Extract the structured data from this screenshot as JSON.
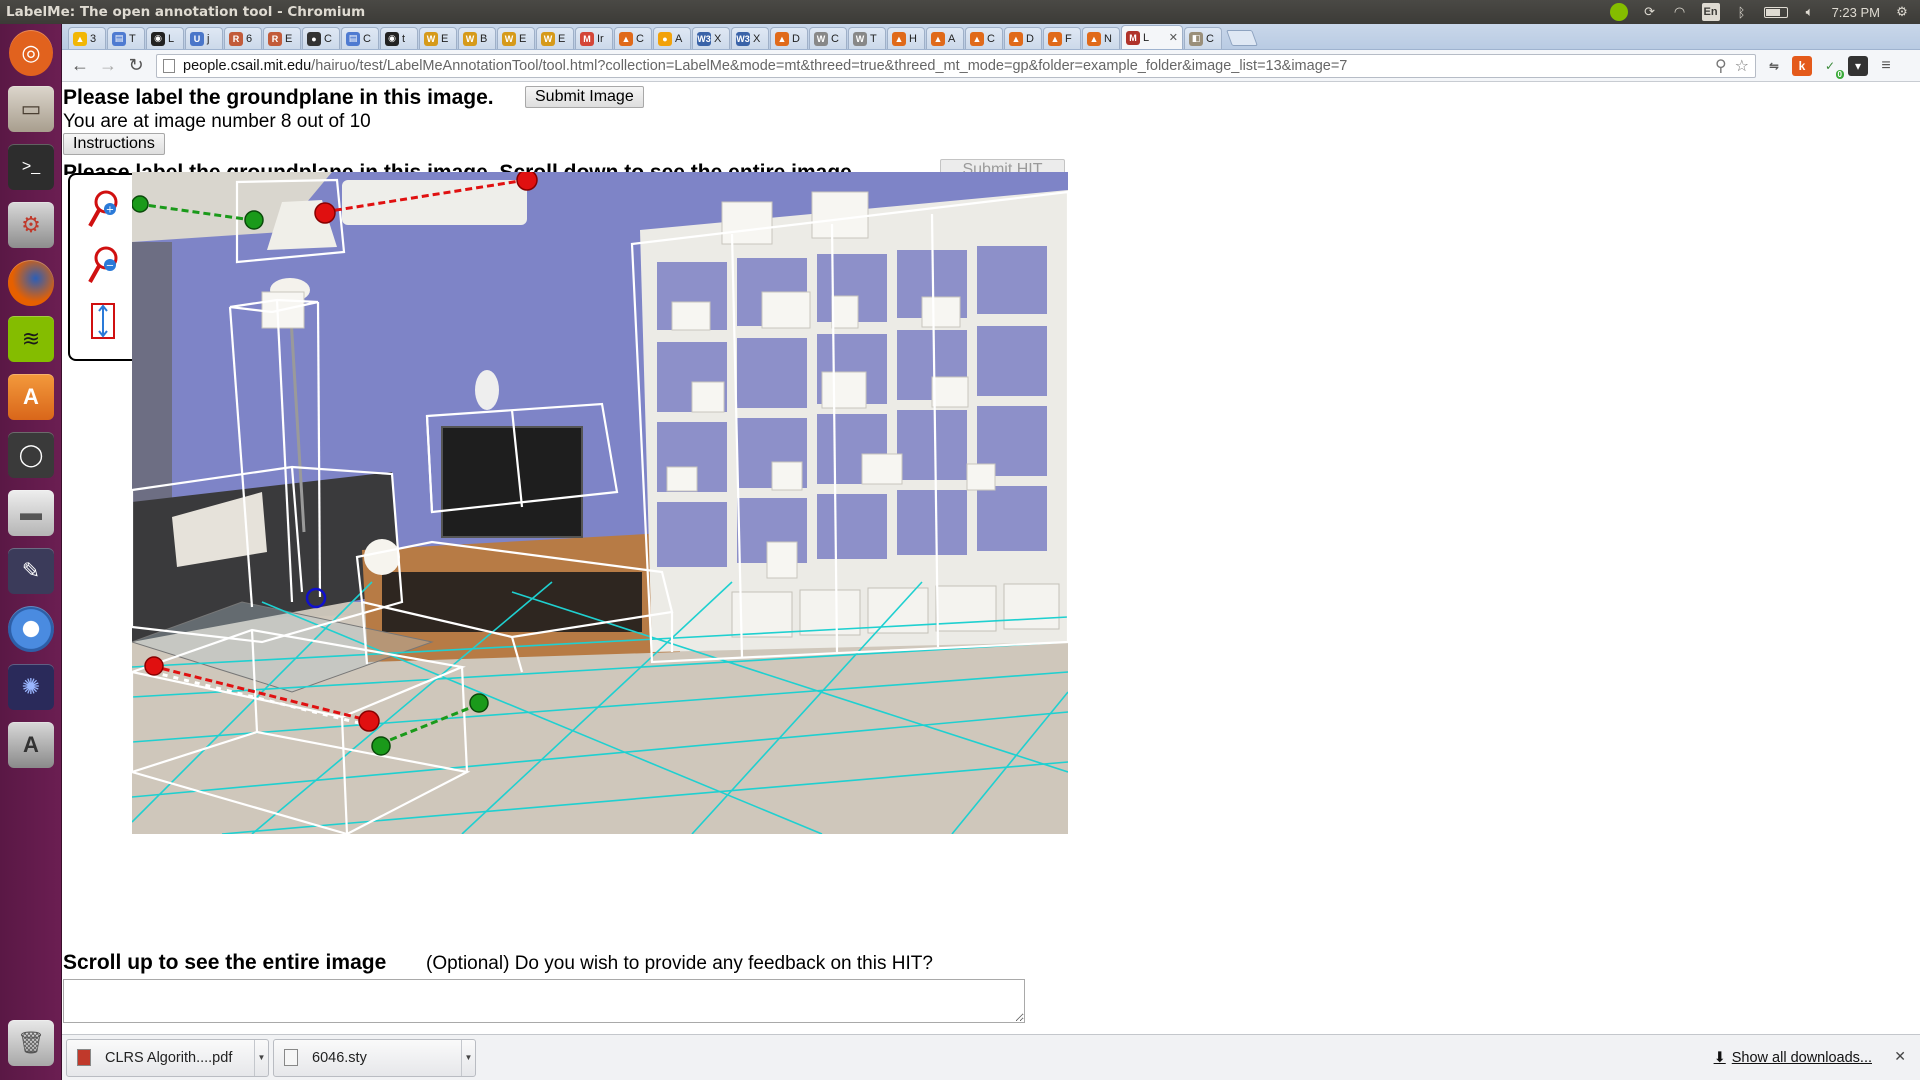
{
  "window": {
    "title": "LabelMe: The open annotation tool - Chromium",
    "clock": "7:23 PM",
    "lang": "En"
  },
  "tabs": [
    {
      "label": "3",
      "color": "#f2b705",
      "glyph": "▲"
    },
    {
      "label": "T",
      "color": "#4f7bd1",
      "glyph": "▤"
    },
    {
      "label": "L",
      "color": "#222222",
      "glyph": "◉"
    },
    {
      "label": "j",
      "color": "#4a76c9",
      "glyph": "U"
    },
    {
      "label": "6",
      "color": "#c25b3a",
      "glyph": "R"
    },
    {
      "label": "E",
      "color": "#c25b3a",
      "glyph": "R"
    },
    {
      "label": "C",
      "color": "#333333",
      "glyph": "●"
    },
    {
      "label": "C",
      "color": "#4f7bd1",
      "glyph": "▤"
    },
    {
      "label": "t",
      "color": "#222222",
      "glyph": "◉"
    },
    {
      "label": "E",
      "color": "#d69a1a",
      "glyph": "W"
    },
    {
      "label": "B",
      "color": "#d69a1a",
      "glyph": "W"
    },
    {
      "label": "E",
      "color": "#d69a1a",
      "glyph": "W"
    },
    {
      "label": "E",
      "color": "#d69a1a",
      "glyph": "W"
    },
    {
      "label": "Ir",
      "color": "#d44638",
      "glyph": "M"
    },
    {
      "label": "C",
      "color": "#e06a1a",
      "glyph": "▲"
    },
    {
      "label": "A",
      "color": "#f2a20a",
      "glyph": "●"
    },
    {
      "label": "X",
      "color": "#3a63a8",
      "glyph": "W3"
    },
    {
      "label": "X",
      "color": "#3a63a8",
      "glyph": "W3"
    },
    {
      "label": "D",
      "color": "#e06a1a",
      "glyph": "▲"
    },
    {
      "label": "C",
      "color": "#888888",
      "glyph": "W"
    },
    {
      "label": "T",
      "color": "#888888",
      "glyph": "W"
    },
    {
      "label": "H",
      "color": "#e06a1a",
      "glyph": "▲"
    },
    {
      "label": "A",
      "color": "#e06a1a",
      "glyph": "▲"
    },
    {
      "label": "C",
      "color": "#e06a1a",
      "glyph": "▲"
    },
    {
      "label": "D",
      "color": "#e06a1a",
      "glyph": "▲"
    },
    {
      "label": "F",
      "color": "#e06a1a",
      "glyph": "▲"
    },
    {
      "label": "N",
      "color": "#e06a1a",
      "glyph": "▲"
    },
    {
      "label": "L",
      "color": "#b0332b",
      "glyph": "M",
      "active": true
    },
    {
      "label": "C",
      "color": "#9a8f7a",
      "glyph": "◧"
    }
  ],
  "toolbar": {
    "url_host": "people.csail.mit.edu",
    "url_path": "/hairuo/test/LabelMeAnnotationTool/tool.html?collection=LabelMe&mode=mt&threed=true&threed_mt_mode=gp&folder=example_folder&image_list=13&image=7",
    "ext_badge": "0"
  },
  "page": {
    "heading": "Please label the groundplane in this image.",
    "submit_image": "Submit Image",
    "image_counter": "You are at image number 8 out of 10",
    "instructions": "Instructions",
    "heading2": "Please label the groundplane in this image. Scroll down to see the entire image.",
    "submit_hit": "Submit HIT",
    "scroll_up": "Scroll up to see the entire image",
    "feedback_question": "(Optional) Do you wish to provide any feedback on this HIT?",
    "feedback_value": ""
  },
  "zoom_tools": [
    {
      "name": "zoom-in-icon"
    },
    {
      "name": "zoom-out-icon"
    },
    {
      "name": "fit-image-icon"
    }
  ],
  "downloads": {
    "items": [
      {
        "name": "CLRS Algorith....pdf",
        "type": "pdf"
      },
      {
        "name": "6046.sty",
        "type": "file"
      }
    ],
    "show_all": "Show all downloads..."
  },
  "colors": {
    "launcher": "#5e1a48",
    "grid": "#1fd0d0",
    "point_red": "#e01010",
    "point_green": "#1a9a1a",
    "point_blue": "#1010cc"
  }
}
